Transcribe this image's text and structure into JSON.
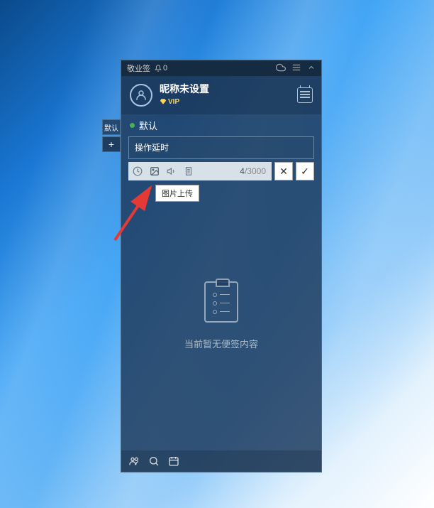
{
  "titlebar": {
    "app_name": "敬业签",
    "notification_count": "0"
  },
  "header": {
    "nickname": "昵称未设置",
    "vip_label": "VIP"
  },
  "category": {
    "name": "默认"
  },
  "side_tabs": {
    "default_short": "默认",
    "add": "+"
  },
  "editor": {
    "text": "操作延时",
    "tooltip": "图片上传",
    "count_current": "4",
    "count_sep": "/",
    "count_max": "3000",
    "cancel": "✕",
    "confirm": "✓"
  },
  "empty": {
    "message": "当前暂无便签内容"
  }
}
